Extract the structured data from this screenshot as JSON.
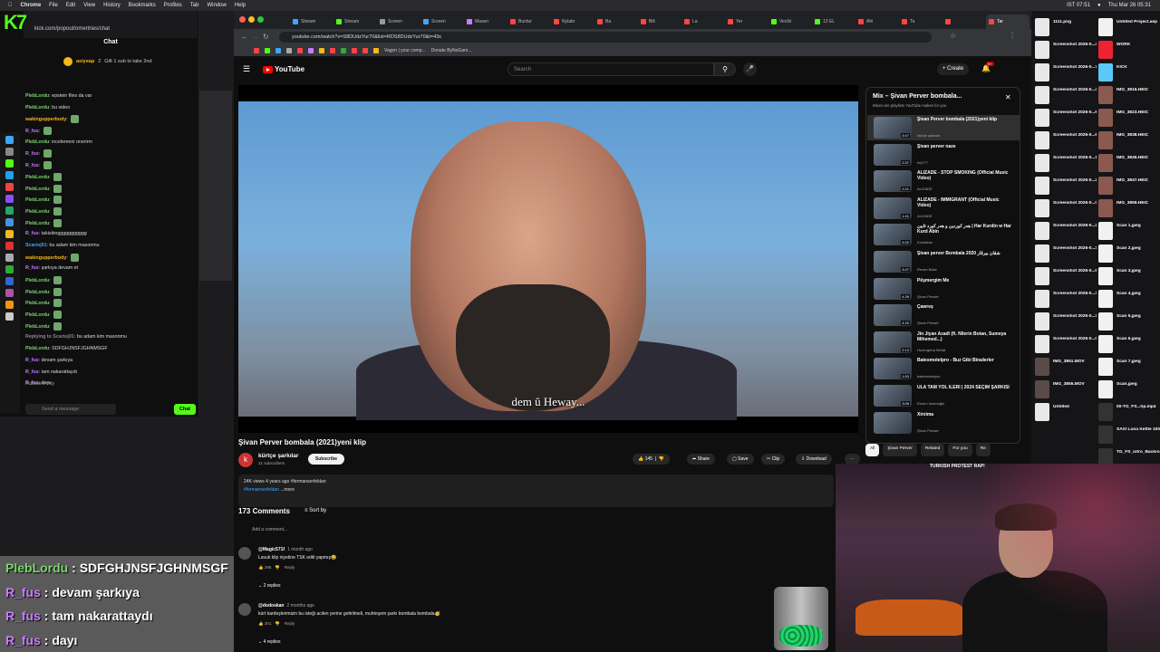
{
  "menubar": {
    "items": [
      "Chrome",
      "File",
      "Edit",
      "View",
      "History",
      "Bookmarks",
      "Profiles",
      "Tab",
      "Window",
      "Help"
    ],
    "clock_ist": "IST 07:51",
    "datetime": "Thu Mar 26 05:31"
  },
  "kick": {
    "logo": "K7",
    "url": "kick.com/popout/omertries/chat",
    "chat_title": "Chat",
    "gift_user": "asiyeap",
    "gift_count": "2",
    "gift_text": "Gift 1 sub to take 2nd",
    "messages": [
      {
        "user": "PlebLordu",
        "text": "epstein files da var",
        "color": "#7bd66c"
      },
      {
        "user": "PlebLordu",
        "text": "bu video",
        "color": "#7bd66c"
      },
      {
        "user": "wakingupperbody",
        "text": "",
        "color": "#f6b81a",
        "emote": true
      },
      {
        "user": "R_fus",
        "text": "",
        "color": "#c77dff",
        "emote": true
      },
      {
        "user": "PlebLordu",
        "text": "incelemeni onerirm",
        "color": "#7bd66c"
      },
      {
        "user": "R_fus",
        "text": "",
        "color": "#c77dff",
        "emote": true
      },
      {
        "user": "R_fus",
        "text": "",
        "color": "#c77dff",
        "emote": true
      },
      {
        "user": "PlebLordu",
        "text": "",
        "color": "#7bd66c",
        "emote": true
      },
      {
        "user": "PlebLordu",
        "text": "",
        "color": "#7bd66c",
        "emote": true
      },
      {
        "user": "PlebLordu",
        "text": "",
        "color": "#7bd66c",
        "emote": true
      },
      {
        "user": "PlebLordu",
        "text": "",
        "color": "#7bd66c",
        "emote": true
      },
      {
        "user": "PlebLordu",
        "text": "",
        "color": "#7bd66c",
        "emote": true
      },
      {
        "user": "R_fus",
        "text": "takiskinggggggggggg",
        "color": "#c77dff"
      },
      {
        "user": "Scarioj01",
        "text": "bu adam kim masonmu",
        "color": "#3ea6ff"
      },
      {
        "user": "wakingupperbody",
        "text": "",
        "color": "#f6b81a",
        "emote": true
      },
      {
        "user": "R_fus",
        "text": "şarkıya devam et",
        "color": "#c77dff"
      },
      {
        "user": "PlebLordu",
        "text": "",
        "color": "#7bd66c",
        "emote": true
      },
      {
        "user": "PlebLordu",
        "text": "",
        "color": "#7bd66c",
        "emote": true
      },
      {
        "user": "PlebLordu",
        "text": "",
        "color": "#7bd66c",
        "emote": true
      },
      {
        "user": "PlebLordu",
        "text": "",
        "color": "#7bd66c",
        "emote": true
      },
      {
        "user": "PlebLordu",
        "text": "",
        "color": "#7bd66c",
        "emote": true
      },
      {
        "user": "Replying to Scarioj01",
        "text": "bu adam kim masonmu",
        "color": "#888"
      },
      {
        "user": "PlebLordu",
        "text": "SDFGHJNSFJGHNMSGF",
        "color": "#7bd66c"
      },
      {
        "user": "R_fus",
        "text": "devam şarkıya",
        "color": "#c77dff"
      },
      {
        "user": "R_fus",
        "text": "tam nakarattaydı",
        "color": "#c77dff"
      },
      {
        "user": "R_fus",
        "text": "dayı",
        "color": "#c77dff"
      }
    ],
    "followers_only": "Followers only",
    "send_placeholder": "Send a message",
    "chat_button": "Chat"
  },
  "overlay_chat": [
    {
      "user": "PlebLordu",
      "text": "SDFGHJNSFJGHNMSGF",
      "cls": "u1"
    },
    {
      "user": "R_fus",
      "text": "devam şarkıya",
      "cls": "u2"
    },
    {
      "user": "R_fus",
      "text": "tam nakarattaydı",
      "cls": "u2"
    },
    {
      "user": "R_fus",
      "text": "dayı",
      "cls": "u2"
    }
  ],
  "browser": {
    "tabs": [
      {
        "label": "Stream",
        "color": "#3ea6ff"
      },
      {
        "label": "Stream",
        "color": "#53fc18"
      },
      {
        "label": "Screen",
        "color": "#999"
      },
      {
        "label": "Screen",
        "color": "#3ea6ff"
      },
      {
        "label": "Masen",
        "color": "#c77dff"
      },
      {
        "label": "Burdur",
        "color": "#ff4444"
      },
      {
        "label": "Nylabr",
        "color": "#ff4444"
      },
      {
        "label": "Ba",
        "color": "#ff4444"
      },
      {
        "label": "Bili",
        "color": "#ff4444"
      },
      {
        "label": "La",
        "color": "#ff4444"
      },
      {
        "label": "Yer",
        "color": "#ff4444"
      },
      {
        "label": "Vecihi",
        "color": "#53fc18"
      },
      {
        "label": "13 EL",
        "color": "#53fc18"
      },
      {
        "label": "Ahi",
        "color": "#ff4444"
      },
      {
        "label": "Ta",
        "color": "#ff4444"
      },
      {
        "label": "",
        "color": "#ff4444"
      },
      {
        "label": "Tar",
        "color": "#ff4444"
      }
    ],
    "url": "youtube.com/watch?v=S8DUdzYur70&list=RDS8DUdzYur70&t=43s",
    "bookmarks": [
      "Vagon | your comp...",
      "Donate ByNoGam..."
    ]
  },
  "youtube": {
    "logo": "YouTube",
    "search_placeholder": "Search",
    "create": "Create",
    "notif_badge": "9+",
    "subtitle": "dem û Heway...",
    "video_title": "Şivan Perver bombala (2021)yeni klip",
    "channel": "kürtçe şarkılar",
    "subscribers": "21 subscribers",
    "subscribe": "Subscribe",
    "likes": "145",
    "share": "Share",
    "save": "Save",
    "clip": "Clip",
    "download": "Download",
    "meta": "24K views  4 years ago",
    "meta_tag": "#fermanserfeldan",
    "desc_tag": "#fermanserfeldan",
    "more": "...more",
    "comments_count": "173 Comments",
    "sort_by": "Sort by",
    "add_comment": "Add a comment...",
    "comments": [
      {
        "author": "@Magic571f",
        "ago": "1 month ago",
        "text": "Lavuk klip niyetine TSK editi yapmış😂",
        "likes": "295",
        "reply": "Reply",
        "replies": "2 replies"
      },
      {
        "author": "@dodoskan",
        "ago": "2 months ago",
        "text": "kürt kardeşlerimizin bu isteği acilen yerine getirilmeli, muhteşem şarkı bombala bombala🥳",
        "likes": "201",
        "reply": "Reply",
        "replies": "4 replies"
      }
    ],
    "playlist": {
      "title": "Mix – Şivan Perver bombala...",
      "subtitle": "Mixes are playlists YouTube makes for you",
      "items": [
        {
          "name": "Şivan Perver bombala (2021)yeni klip",
          "channel": "kürtçe şarkılar",
          "dur": "3:47",
          "cur": true
        },
        {
          "name": "Şivan perver naze",
          "channel": "tmj777",
          "dur": "2:37",
          "cur": false
        },
        {
          "name": "ALIZADE - STOP SMOKING (Official Music Video)",
          "channel": "ALIZADE",
          "dur": "2:21",
          "cur": false
        },
        {
          "name": "ALIZADE - IMMIGRANT (Official Music Video)",
          "channel": "ALIZADE",
          "dur": "1:41",
          "cur": false
        },
        {
          "name": "هەر کوردین و هەر کورد ئابین | Har Kurdin w Har Kurd Abin",
          "channel": "Kurdistan",
          "dur": "4:02",
          "cur": false
        },
        {
          "name": "Şivan perver Bombala شڤان بیرڤار 2020",
          "channel": "Rezan Bakir",
          "dur": "3:47",
          "cur": false
        },
        {
          "name": "Pêşmergim Me",
          "channel": "Şivan Perwer",
          "dur": "4:39",
          "cur": false
        },
        {
          "name": "Çawreş",
          "channel": "Şivan Perwer",
          "dur": "4:20",
          "cur": false
        },
        {
          "name": "Jin Jiyan Azadî (ft. Nîlerin Botan, Sumeya Mihemed...)",
          "channel": "Hunergeha Welat",
          "dur": "2:13",
          "cur": false
        },
        {
          "name": "Batesmotelpro - Buz Gibi Biraderler",
          "channel": "batesmotelpro",
          "dur": "1:53",
          "cur": false
        },
        {
          "name": "ULA TAM YOL İLERİ | 2024 SEÇİM ŞARKISI",
          "channel": "Ekrem İmamoğlu",
          "dur": "3:08",
          "cur": false
        },
        {
          "name": "Xirxima",
          "channel": "Şivan Perwer",
          "dur": "",
          "cur": false
        }
      ]
    },
    "chips": [
      "All",
      "Şivan Perver",
      "Related",
      "For you",
      "Re"
    ],
    "next_label": "TURKISH PROTEST RAP!"
  },
  "desktop": {
    "files_col1": [
      "1111.png",
      "Screenshot 2026-0...44.55",
      "Screenshot 2026-0...7.58.53",
      "Screenshot 2026-0...42.20",
      "Screenshot 2026-0...6.08.01",
      "Screenshot 2026-0...6.08.15",
      "Screenshot 2026-0...1.13.05",
      "Screenshot 2026-0...29.25",
      "Screenshot 2026-0...03.47",
      "Screenshot 2026-0...29.54",
      "Screenshot 2026-0...3.57.13",
      "Screenshot 2026-0...5.38.21",
      "Screenshot 2026-0...32.57",
      "Screenshot 2026-0...32.27",
      "Screenshot 2026-0...02.59",
      "IMG_3851.MOV",
      "IMG_3855.MOV",
      "Untitled"
    ],
    "files_col2": [
      "Untitled Project.aep",
      "WORK",
      "KICK",
      "IMG_3816.HEIC",
      "IMG_3823.HEIC",
      "IMG_3838.HEIC",
      "IMG_3845.HEIC",
      "IMG_3847.HEIC",
      "IMG_3859.HEIC",
      "Scan 1.jpeg",
      "Scan 2.jpeg",
      "Scan 3.jpeg",
      "Scan 4.jpeg",
      "Scan 5.jpeg",
      "Scan 6.jpeg",
      "Scan 7.jpeg",
      "Scan.jpeg",
      "00-TG_FS...hp.mp4",
      "SAXI Luna Kettle 100%...ste.mp4",
      "TG_FS_intro_Backroom...la.mp4"
    ]
  }
}
